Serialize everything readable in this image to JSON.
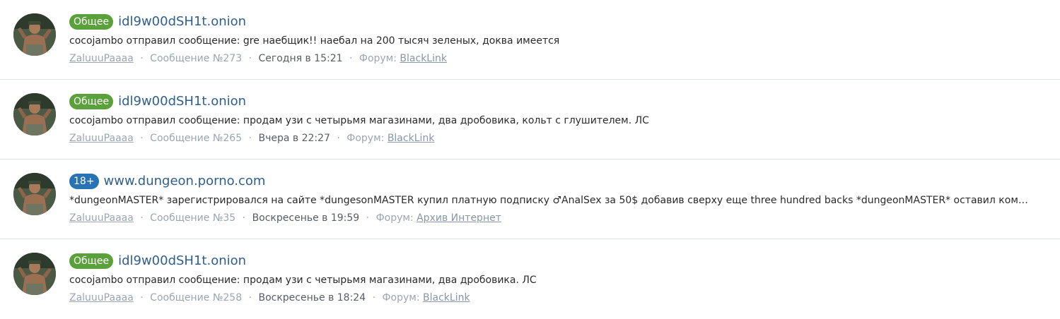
{
  "results": [
    {
      "tag": "Общее",
      "tag_type": "general",
      "title": "idl9w00dSH1t.onion",
      "snippet": "cocojambo отправил сообщение: gre наебщик!! наебал на 200 тысяч зеленых, доква имеется",
      "user": "ZaluuuPaaaa",
      "post": "Сообщение №273",
      "date": "Сегодня в 15:21",
      "forum_label": "Форум:",
      "forum": "BlackLink"
    },
    {
      "tag": "Общее",
      "tag_type": "general",
      "title": "idl9w00dSH1t.onion",
      "snippet": "cocojambo отправил сообщение: продам узи с четырьмя магазинами, два дробовика, кольт с глушителем. ЛС",
      "user": "ZaluuuPaaaa",
      "post": "Сообщение №265",
      "date": "Вчера в 22:27",
      "forum_label": "Форум:",
      "forum": "BlackLink"
    },
    {
      "tag": "18+",
      "tag_type": "adult",
      "title": "www.dungeon.porno.com",
      "snippet": "*dungeonMASTER* зарегистрировался на сайте *dungesonMASTER купил платную подписку ♂AnalSex за 50$ добавив сверху еще three hundred backs *dungeonMASTER* оставил комментарий: о да..",
      "user": "ZaluuuPaaaa",
      "post": "Сообщение №35",
      "date": "Воскресенье в 19:59",
      "forum_label": "Форум:",
      "forum": "Архив Интернет"
    },
    {
      "tag": "Общее",
      "tag_type": "general",
      "title": "idl9w00dSH1t.onion",
      "snippet": "cocojambo отправил сообщение: продам узи с четырьмя магазинами, два дробовика. ЛС",
      "user": "ZaluuuPaaaa",
      "post": "Сообщение №258",
      "date": "Воскресенье в 18:24",
      "forum_label": "Форум:",
      "forum": "BlackLink"
    }
  ],
  "meta_separator": "·",
  "colors": {
    "tag_general": "#5ba13b",
    "tag_adult": "#2873b3",
    "title": "#2f5f8d",
    "meta": "#9aa6b4"
  },
  "avatar_icon": "user-avatar-photo"
}
